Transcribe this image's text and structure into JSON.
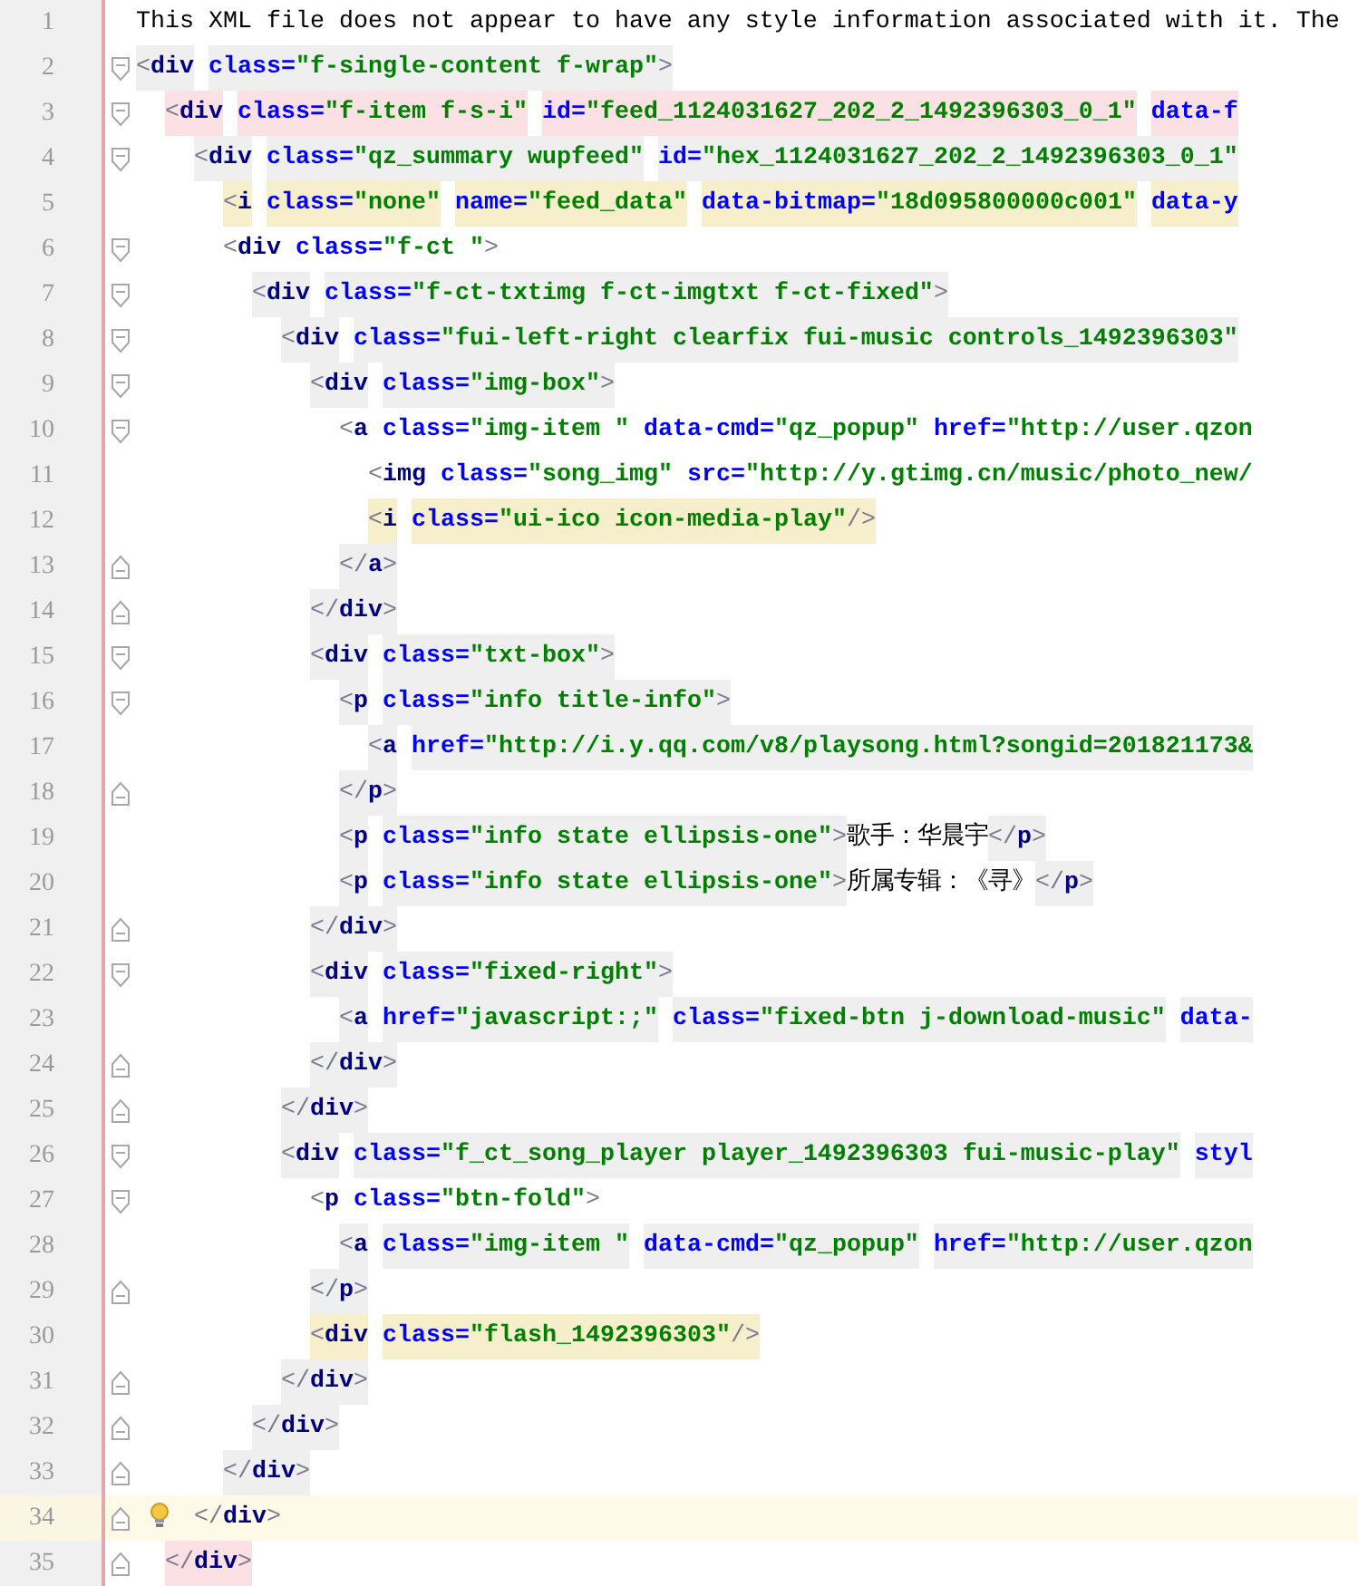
{
  "editor": {
    "lines": [
      {
        "number": "1",
        "kind": "plain",
        "current": false,
        "bulb": false,
        "tokens": [
          {
            "kind": "text",
            "text": "This XML file does not appear to have any style information associated with it. The"
          }
        ]
      },
      {
        "number": "2",
        "kind": "fold-start",
        "color": "#efefef",
        "current": false,
        "bulb": false,
        "tokens": [
          {
            "kind": "punct",
            "text": "<"
          },
          {
            "kind": "tag",
            "text": "div"
          },
          {
            "kind": "attr",
            "text": " class="
          },
          {
            "kind": "value",
            "text": "\"f-single-content f-wrap\""
          },
          {
            "kind": "punct",
            "text": ">"
          }
        ]
      },
      {
        "number": "3",
        "kind": "fold-start",
        "color": "#fbe1e3",
        "current": false,
        "bulb": false,
        "tokens": [
          {
            "kind": "punct",
            "text": "  <"
          },
          {
            "kind": "tag",
            "text": "div"
          },
          {
            "kind": "attr",
            "text": " class="
          },
          {
            "kind": "value",
            "text": "\"f-item f-s-i\""
          },
          {
            "kind": "attr",
            "text": " id="
          },
          {
            "kind": "value",
            "text": "\"feed_1124031627_202_2_1492396303_0_1\""
          },
          {
            "kind": "attr",
            "text": " data-f"
          }
        ]
      },
      {
        "number": "4",
        "kind": "fold-start",
        "color": "#efefef",
        "current": false,
        "bulb": false,
        "tokens": [
          {
            "kind": "punct",
            "text": "    <"
          },
          {
            "kind": "tag",
            "text": "div"
          },
          {
            "kind": "attr",
            "text": " class="
          },
          {
            "kind": "value",
            "text": "\"qz_summary wupfeed\""
          },
          {
            "kind": "attr",
            "text": " id="
          },
          {
            "kind": "value",
            "text": "\"hex_1124031627_202_2_1492396303_0_1\""
          }
        ]
      },
      {
        "number": "5",
        "kind": "plain",
        "color": "#f7efcc",
        "current": false,
        "bulb": false,
        "tokens": [
          {
            "kind": "punct",
            "text": "      <"
          },
          {
            "kind": "tag",
            "text": "i"
          },
          {
            "kind": "attr",
            "text": " class="
          },
          {
            "kind": "value",
            "text": "\"none\""
          },
          {
            "kind": "attr",
            "text": " name="
          },
          {
            "kind": "value",
            "text": "\"feed_data\""
          },
          {
            "kind": "attr",
            "text": " data-bitmap="
          },
          {
            "kind": "value",
            "text": "\"18d095800000c001\""
          },
          {
            "kind": "attr",
            "text": " data-y"
          }
        ]
      },
      {
        "number": "6",
        "kind": "fold-start",
        "current": false,
        "bulb": false,
        "tokens": [
          {
            "kind": "punct",
            "text": "      <"
          },
          {
            "kind": "tag",
            "text": "div"
          },
          {
            "kind": "attr",
            "text": " class="
          },
          {
            "kind": "value",
            "text": "\"f-ct \""
          },
          {
            "kind": "punct",
            "text": ">"
          }
        ]
      },
      {
        "number": "7",
        "kind": "fold-start",
        "color": "#efefef",
        "current": false,
        "bulb": false,
        "tokens": [
          {
            "kind": "punct",
            "text": "        <"
          },
          {
            "kind": "tag",
            "text": "div"
          },
          {
            "kind": "attr",
            "text": " class="
          },
          {
            "kind": "value",
            "text": "\"f-ct-txtimg f-ct-imgtxt f-ct-fixed\""
          },
          {
            "kind": "punct",
            "text": ">"
          }
        ]
      },
      {
        "number": "8",
        "kind": "fold-start",
        "color": "#efefef",
        "current": false,
        "bulb": false,
        "tokens": [
          {
            "kind": "punct",
            "text": "          <"
          },
          {
            "kind": "tag",
            "text": "div"
          },
          {
            "kind": "attr",
            "text": " class="
          },
          {
            "kind": "value",
            "text": "\"fui-left-right clearfix fui-music controls_1492396303\""
          }
        ]
      },
      {
        "number": "9",
        "kind": "fold-start",
        "color": "#efefef",
        "current": false,
        "bulb": false,
        "tokens": [
          {
            "kind": "punct",
            "text": "            <"
          },
          {
            "kind": "tag",
            "text": "div"
          },
          {
            "kind": "attr",
            "text": " class="
          },
          {
            "kind": "value",
            "text": "\"img-box\""
          },
          {
            "kind": "punct",
            "text": ">"
          }
        ]
      },
      {
        "number": "10",
        "kind": "fold-start",
        "current": false,
        "bulb": false,
        "tokens": [
          {
            "kind": "punct",
            "text": "              <"
          },
          {
            "kind": "tag",
            "text": "a"
          },
          {
            "kind": "attr",
            "text": " class="
          },
          {
            "kind": "value",
            "text": "\"img-item \""
          },
          {
            "kind": "attr",
            "text": " data-cmd="
          },
          {
            "kind": "value",
            "text": "\"qz_popup\""
          },
          {
            "kind": "attr",
            "text": " href="
          },
          {
            "kind": "value",
            "text": "\"http://user.qzon"
          }
        ]
      },
      {
        "number": "11",
        "kind": "plain",
        "current": false,
        "bulb": false,
        "tokens": [
          {
            "kind": "punct",
            "text": "                <"
          },
          {
            "kind": "tag",
            "text": "img"
          },
          {
            "kind": "attr",
            "text": " class="
          },
          {
            "kind": "value",
            "text": "\"song_img\""
          },
          {
            "kind": "attr",
            "text": " src="
          },
          {
            "kind": "value",
            "text": "\"http://y.gtimg.cn/music/photo_new/"
          }
        ]
      },
      {
        "number": "12",
        "kind": "plain",
        "color": "#f7efcc",
        "current": false,
        "bulb": false,
        "tokens": [
          {
            "kind": "punct",
            "text": "                <"
          },
          {
            "kind": "tag",
            "text": "i"
          },
          {
            "kind": "attr",
            "text": " class="
          },
          {
            "kind": "value",
            "text": "\"ui-ico icon-media-play\""
          },
          {
            "kind": "punct",
            "text": "/>"
          }
        ]
      },
      {
        "number": "13",
        "kind": "fold-end",
        "color": "#efefef",
        "current": false,
        "bulb": false,
        "tokens": [
          {
            "kind": "punct",
            "text": "              </"
          },
          {
            "kind": "tag",
            "text": "a"
          },
          {
            "kind": "punct",
            "text": ">"
          }
        ]
      },
      {
        "number": "14",
        "kind": "fold-end",
        "color": "#efefef",
        "current": false,
        "bulb": false,
        "tokens": [
          {
            "kind": "punct",
            "text": "            </"
          },
          {
            "kind": "tag",
            "text": "div"
          },
          {
            "kind": "punct",
            "text": ">"
          }
        ]
      },
      {
        "number": "15",
        "kind": "fold-start",
        "color": "#efefef",
        "current": false,
        "bulb": false,
        "tokens": [
          {
            "kind": "punct",
            "text": "            <"
          },
          {
            "kind": "tag",
            "text": "div"
          },
          {
            "kind": "attr",
            "text": " class="
          },
          {
            "kind": "value",
            "text": "\"txt-box\""
          },
          {
            "kind": "punct",
            "text": ">"
          }
        ]
      },
      {
        "number": "16",
        "kind": "fold-start",
        "color": "#efefef",
        "current": false,
        "bulb": false,
        "tokens": [
          {
            "kind": "punct",
            "text": "              <"
          },
          {
            "kind": "tag",
            "text": "p"
          },
          {
            "kind": "attr",
            "text": " class="
          },
          {
            "kind": "value",
            "text": "\"info title-info\""
          },
          {
            "kind": "punct",
            "text": ">"
          }
        ]
      },
      {
        "number": "17",
        "kind": "plain",
        "color": "#efefef",
        "current": false,
        "bulb": false,
        "tokens": [
          {
            "kind": "punct",
            "text": "                <"
          },
          {
            "kind": "tag",
            "text": "a"
          },
          {
            "kind": "attr",
            "text": " href="
          },
          {
            "kind": "value",
            "text": "\"http://i.y.qq.com/v8/playsong.html?songid=201821173&"
          }
        ]
      },
      {
        "number": "18",
        "kind": "fold-end",
        "color": "#efefef",
        "current": false,
        "bulb": false,
        "tokens": [
          {
            "kind": "punct",
            "text": "              </"
          },
          {
            "kind": "tag",
            "text": "p"
          },
          {
            "kind": "punct",
            "text": ">"
          }
        ]
      },
      {
        "number": "19",
        "kind": "plain",
        "color": "#efefef",
        "current": false,
        "bulb": false,
        "tokens": [
          {
            "kind": "punct",
            "text": "              <"
          },
          {
            "kind": "tag",
            "text": "p"
          },
          {
            "kind": "attr",
            "text": " class="
          },
          {
            "kind": "value",
            "text": "\"info state ellipsis-one\""
          },
          {
            "kind": "punct",
            "text": ">"
          },
          {
            "kind": "text",
            "text": "歌手：华晨宇"
          },
          {
            "kind": "punct",
            "text": "</"
          },
          {
            "kind": "tag",
            "text": "p"
          },
          {
            "kind": "punct",
            "text": ">"
          }
        ]
      },
      {
        "number": "20",
        "kind": "plain",
        "color": "#efefef",
        "current": false,
        "bulb": false,
        "tokens": [
          {
            "kind": "punct",
            "text": "              <"
          },
          {
            "kind": "tag",
            "text": "p"
          },
          {
            "kind": "attr",
            "text": " class="
          },
          {
            "kind": "value",
            "text": "\"info state ellipsis-one\""
          },
          {
            "kind": "punct",
            "text": ">"
          },
          {
            "kind": "text",
            "text": "所属专辑：《寻》"
          },
          {
            "kind": "punct",
            "text": "</"
          },
          {
            "kind": "tag",
            "text": "p"
          },
          {
            "kind": "punct",
            "text": ">"
          }
        ]
      },
      {
        "number": "21",
        "kind": "fold-end",
        "color": "#efefef",
        "current": false,
        "bulb": false,
        "tokens": [
          {
            "kind": "punct",
            "text": "            </"
          },
          {
            "kind": "tag",
            "text": "div"
          },
          {
            "kind": "punct",
            "text": ">"
          }
        ]
      },
      {
        "number": "22",
        "kind": "fold-start",
        "color": "#efefef",
        "current": false,
        "bulb": false,
        "tokens": [
          {
            "kind": "punct",
            "text": "            <"
          },
          {
            "kind": "tag",
            "text": "div"
          },
          {
            "kind": "attr",
            "text": " class="
          },
          {
            "kind": "value",
            "text": "\"fixed-right\""
          },
          {
            "kind": "punct",
            "text": ">"
          }
        ]
      },
      {
        "number": "23",
        "kind": "plain",
        "color": "#efefef",
        "current": false,
        "bulb": false,
        "tokens": [
          {
            "kind": "punct",
            "text": "              <"
          },
          {
            "kind": "tag",
            "text": "a"
          },
          {
            "kind": "attr",
            "text": " href="
          },
          {
            "kind": "value",
            "text": "\"javascript:;\""
          },
          {
            "kind": "attr",
            "text": " class="
          },
          {
            "kind": "value",
            "text": "\"fixed-btn j-download-music\""
          },
          {
            "kind": "attr",
            "text": " data-"
          }
        ]
      },
      {
        "number": "24",
        "kind": "fold-end",
        "color": "#efefef",
        "current": false,
        "bulb": false,
        "tokens": [
          {
            "kind": "punct",
            "text": "            </"
          },
          {
            "kind": "tag",
            "text": "div"
          },
          {
            "kind": "punct",
            "text": ">"
          }
        ]
      },
      {
        "number": "25",
        "kind": "fold-end",
        "color": "#efefef",
        "current": false,
        "bulb": false,
        "tokens": [
          {
            "kind": "punct",
            "text": "          </"
          },
          {
            "kind": "tag",
            "text": "div"
          },
          {
            "kind": "punct",
            "text": ">"
          }
        ]
      },
      {
        "number": "26",
        "kind": "fold-start",
        "color": "#efefef",
        "current": false,
        "bulb": false,
        "tokens": [
          {
            "kind": "punct",
            "text": "          <"
          },
          {
            "kind": "tag",
            "text": "div"
          },
          {
            "kind": "attr",
            "text": " class="
          },
          {
            "kind": "value",
            "text": "\"f_ct_song_player player_1492396303 fui-music-play\""
          },
          {
            "kind": "attr",
            "text": " styl"
          }
        ]
      },
      {
        "number": "27",
        "kind": "fold-start",
        "current": false,
        "bulb": false,
        "tokens": [
          {
            "kind": "punct",
            "text": "            <"
          },
          {
            "kind": "tag",
            "text": "p"
          },
          {
            "kind": "attr",
            "text": " class="
          },
          {
            "kind": "value",
            "text": "\"btn-fold\""
          },
          {
            "kind": "punct",
            "text": ">"
          }
        ]
      },
      {
        "number": "28",
        "kind": "plain",
        "color": "#efefef",
        "current": false,
        "bulb": false,
        "tokens": [
          {
            "kind": "punct",
            "text": "              <"
          },
          {
            "kind": "tag",
            "text": "a"
          },
          {
            "kind": "attr",
            "text": " class="
          },
          {
            "kind": "value",
            "text": "\"img-item \""
          },
          {
            "kind": "attr",
            "text": " data-cmd="
          },
          {
            "kind": "value",
            "text": "\"qz_popup\""
          },
          {
            "kind": "attr",
            "text": " href="
          },
          {
            "kind": "value",
            "text": "\"http://user.qzon"
          }
        ]
      },
      {
        "number": "29",
        "kind": "fold-end",
        "color": "#efefef",
        "current": false,
        "bulb": false,
        "tokens": [
          {
            "kind": "punct",
            "text": "            </"
          },
          {
            "kind": "tag",
            "text": "p"
          },
          {
            "kind": "punct",
            "text": ">"
          }
        ]
      },
      {
        "number": "30",
        "kind": "plain",
        "color": "#f7efcc",
        "current": false,
        "bulb": false,
        "tokens": [
          {
            "kind": "punct",
            "text": "            <"
          },
          {
            "kind": "tag",
            "text": "div"
          },
          {
            "kind": "attr",
            "text": " class="
          },
          {
            "kind": "value",
            "text": "\"flash_1492396303\""
          },
          {
            "kind": "punct",
            "text": "/>"
          }
        ]
      },
      {
        "number": "31",
        "kind": "fold-end",
        "color": "#efefef",
        "current": false,
        "bulb": false,
        "tokens": [
          {
            "kind": "punct",
            "text": "          </"
          },
          {
            "kind": "tag",
            "text": "div"
          },
          {
            "kind": "punct",
            "text": ">"
          }
        ]
      },
      {
        "number": "32",
        "kind": "fold-end",
        "color": "#efefef",
        "current": false,
        "bulb": false,
        "tokens": [
          {
            "kind": "punct",
            "text": "        </"
          },
          {
            "kind": "tag",
            "text": "div"
          },
          {
            "kind": "punct",
            "text": ">"
          }
        ]
      },
      {
        "number": "33",
        "kind": "fold-end",
        "color": "#efefef",
        "current": false,
        "bulb": false,
        "tokens": [
          {
            "kind": "punct",
            "text": "      </"
          },
          {
            "kind": "tag",
            "text": "div"
          },
          {
            "kind": "punct",
            "text": ">"
          }
        ]
      },
      {
        "number": "34",
        "kind": "fold-end",
        "current": true,
        "bulb": true,
        "tokens": [
          {
            "kind": "punct",
            "text": "    </"
          },
          {
            "kind": "tag",
            "text": "div"
          },
          {
            "kind": "punct",
            "text": ">"
          }
        ]
      },
      {
        "number": "35",
        "kind": "fold-end",
        "color": "#fbe1e3",
        "current": false,
        "bulb": false,
        "tokens": [
          {
            "kind": "punct",
            "text": "  </"
          },
          {
            "kind": "tag",
            "text": "div"
          },
          {
            "kind": "punct",
            "text": ">"
          }
        ]
      }
    ]
  }
}
